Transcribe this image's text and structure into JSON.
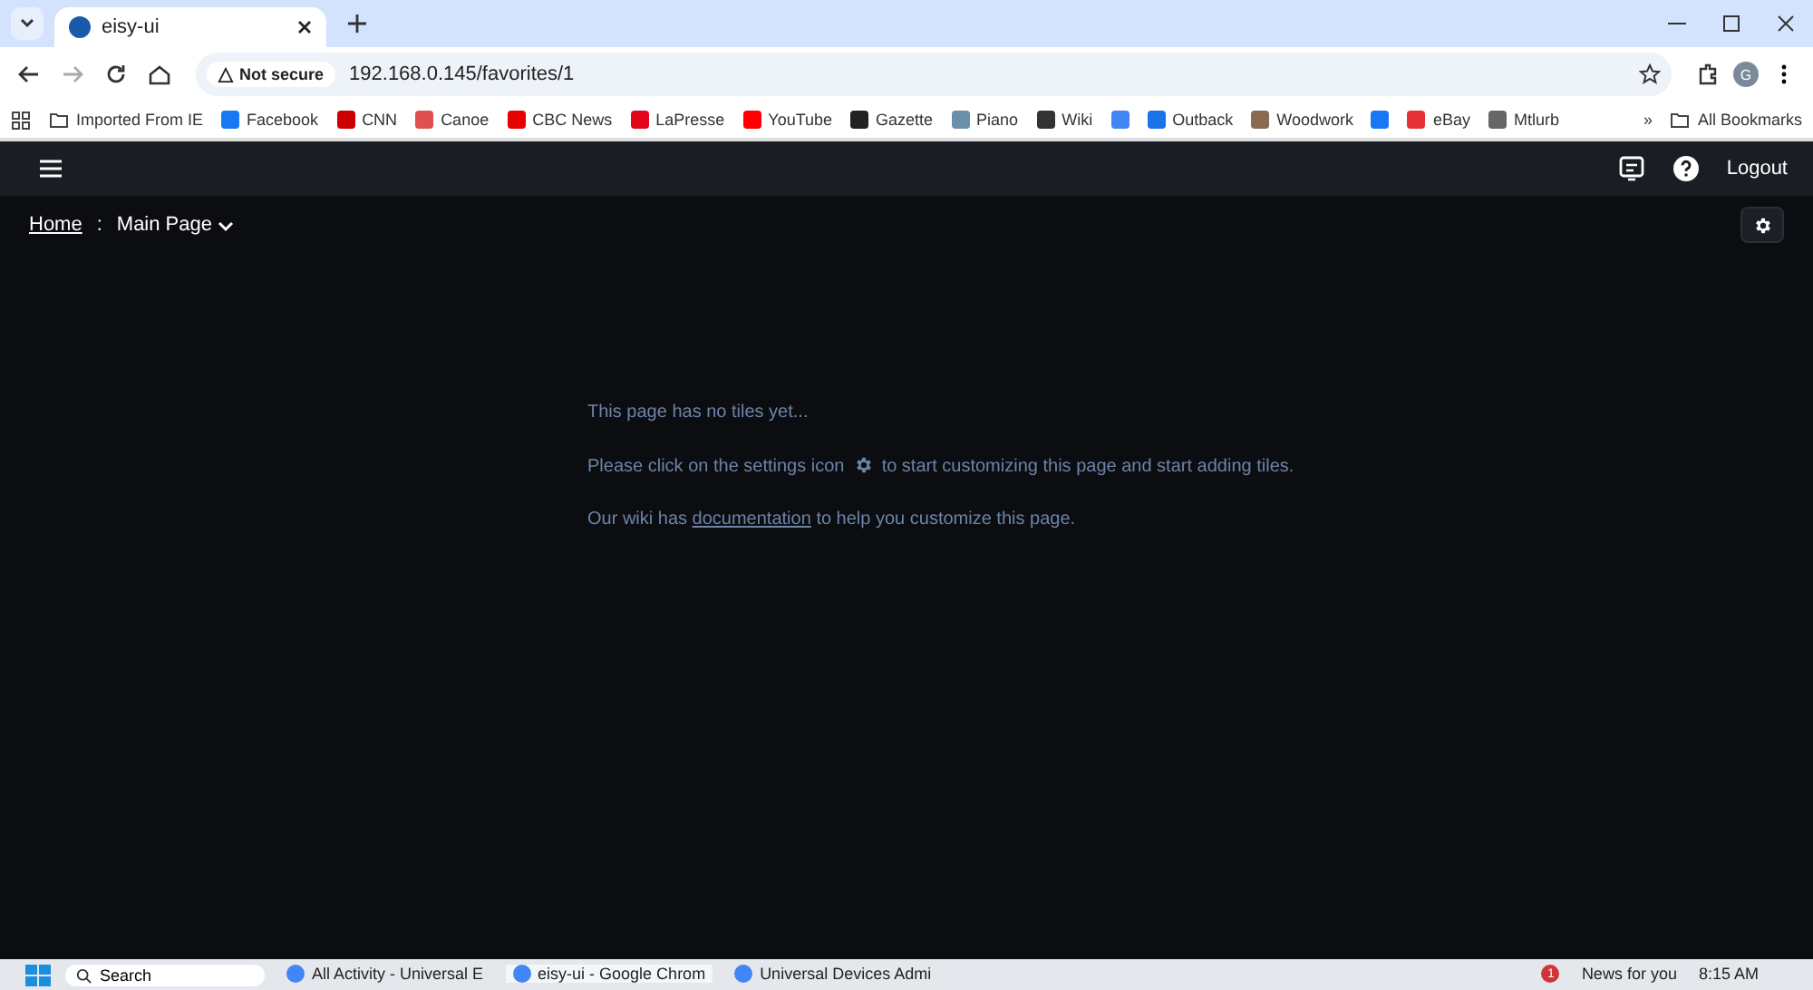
{
  "browser": {
    "tab": {
      "title": "eisy-ui",
      "selected": true
    },
    "security": "Not secure",
    "url": "192.168.0.145/favorites/1",
    "profile": "G"
  },
  "bookmarks": [
    {
      "label": "Imported From IE",
      "kind": "folder"
    },
    {
      "label": "Facebook",
      "kind": "site",
      "color": "#1877f2"
    },
    {
      "label": "CNN",
      "kind": "site",
      "color": "#cc0000"
    },
    {
      "label": "Canoe",
      "kind": "site",
      "color": "#e05050"
    },
    {
      "label": "CBC News",
      "kind": "site",
      "color": "#e60000"
    },
    {
      "label": "LaPresse",
      "kind": "site",
      "color": "#e3051b"
    },
    {
      "label": "YouTube",
      "kind": "site",
      "color": "#ff0000"
    },
    {
      "label": "Gazette",
      "kind": "site",
      "color": "#222222"
    },
    {
      "label": "Piano",
      "kind": "site",
      "color": "#6a8fa8"
    },
    {
      "label": "Wiki",
      "kind": "site",
      "color": "#333333"
    },
    {
      "kind": "site",
      "color": "#4285f4"
    },
    {
      "label": "Outback",
      "kind": "site",
      "color": "#1a73e8"
    },
    {
      "label": "Woodwork",
      "kind": "site",
      "color": "#8a6a50"
    },
    {
      "kind": "site",
      "color": "#1877f2"
    },
    {
      "label": "eBay",
      "kind": "site",
      "color": "#e53238"
    },
    {
      "label": "Mtlurb",
      "kind": "site",
      "color": "#666666"
    }
  ],
  "more_bookmarks": "»",
  "all_bookmarks": "All Bookmarks",
  "app": {
    "logout": "Logout",
    "breadcrumb": {
      "home": "Home",
      "separator": ":",
      "page": "Main Page"
    },
    "message": {
      "line_1": "This page has no tiles yet...",
      "line_2_before": "Please click on the settings icon",
      "line_2_after": "to start customizing this page and start adding tiles.",
      "line_3_before": "Our wiki has",
      "link": "documentation",
      "line_3_after": "to help you customize this page."
    }
  },
  "taskbar": {
    "search": "Search",
    "apps": [
      {
        "label": "All Activity - Universal E",
        "selected": false
      },
      {
        "label": "eisy-ui - Google Chrom",
        "selected": true
      },
      {
        "label": "Universal Devices Admi",
        "selected": false
      }
    ],
    "news": "News for you",
    "news_badge": "1",
    "time": "8:15 AM"
  }
}
